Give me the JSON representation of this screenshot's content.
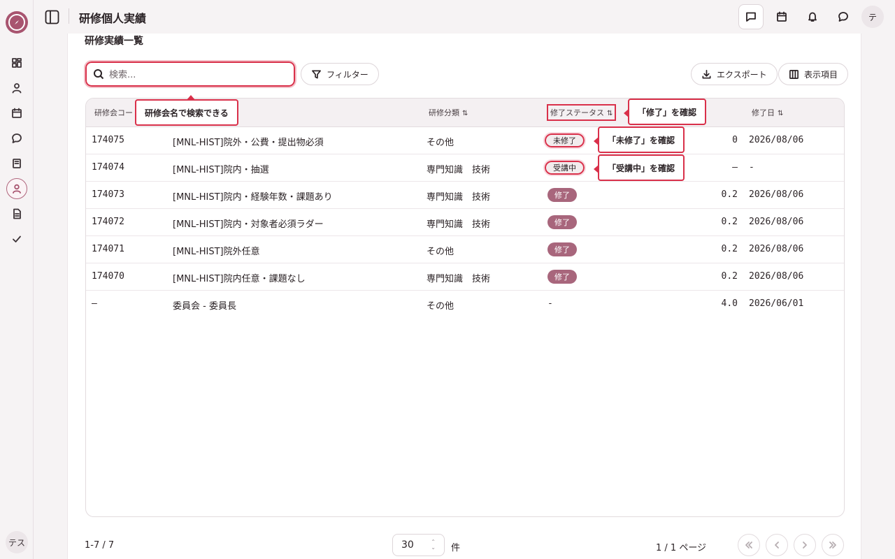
{
  "header": {
    "title": "研修個人実績",
    "avatar_initial": "テ"
  },
  "rail": {
    "user_label": "テス",
    "icons": [
      "dashboard-icon",
      "user-icon",
      "calendar-icon",
      "chat-icon",
      "book-icon",
      "profile-icon",
      "document-icon",
      "check-icon"
    ]
  },
  "section": {
    "title": "研修実績一覧"
  },
  "search": {
    "placeholder": "検索..."
  },
  "toolbar": {
    "filter_label": "フィルター",
    "export_label": "エクスポート",
    "columns_label": "表示項目"
  },
  "table": {
    "columns": {
      "code": "研修会コー",
      "category": "研修分類",
      "status": "修了ステータス",
      "date": "修了日"
    },
    "rows": [
      {
        "code": "174075",
        "name": "[MNL-HIST]院外・公費・提出物必須",
        "category": "その他",
        "status": "未修了",
        "credits": "0",
        "date": "2026/08/06"
      },
      {
        "code": "174074",
        "name": "[MNL-HIST]院内・抽選",
        "category": "専門知識　技術",
        "status": "受講中",
        "credits": "—",
        "date": "-"
      },
      {
        "code": "174073",
        "name": "[MNL-HIST]院内・経験年数・課題あり",
        "category": "専門知識　技術",
        "status": "修了",
        "credits": "0.2",
        "date": "2026/08/06"
      },
      {
        "code": "174072",
        "name": "[MNL-HIST]院内・対象者必須ラダー",
        "category": "専門知識　技術",
        "status": "修了",
        "credits": "0.2",
        "date": "2026/08/06"
      },
      {
        "code": "174071",
        "name": "[MNL-HIST]院外任意",
        "category": "その他",
        "status": "修了",
        "credits": "0.2",
        "date": "2026/08/06"
      },
      {
        "code": "174070",
        "name": "[MNL-HIST]院内任意・課題なし",
        "category": "専門知識　技術",
        "status": "修了",
        "credits": "0.2",
        "date": "2026/08/06"
      },
      {
        "code": "—",
        "name": "委員会 - 委員長",
        "category": "その他",
        "status": "-",
        "credits": "4.0",
        "date": "2026/06/01"
      }
    ]
  },
  "callouts": {
    "search": "研修会名で検索できる",
    "status_done": "「修了」を確認",
    "status_incomplete": "「未修了」を確認",
    "status_inprogress": "「受講中」を確認"
  },
  "footer": {
    "range": "1-7 / 7",
    "page_size": "30",
    "unit": "件",
    "page_info": "1 / 1 ページ"
  },
  "colors": {
    "brand": "#a8546f",
    "highlight": "#d9304a",
    "badge_done": "#a8667c"
  }
}
